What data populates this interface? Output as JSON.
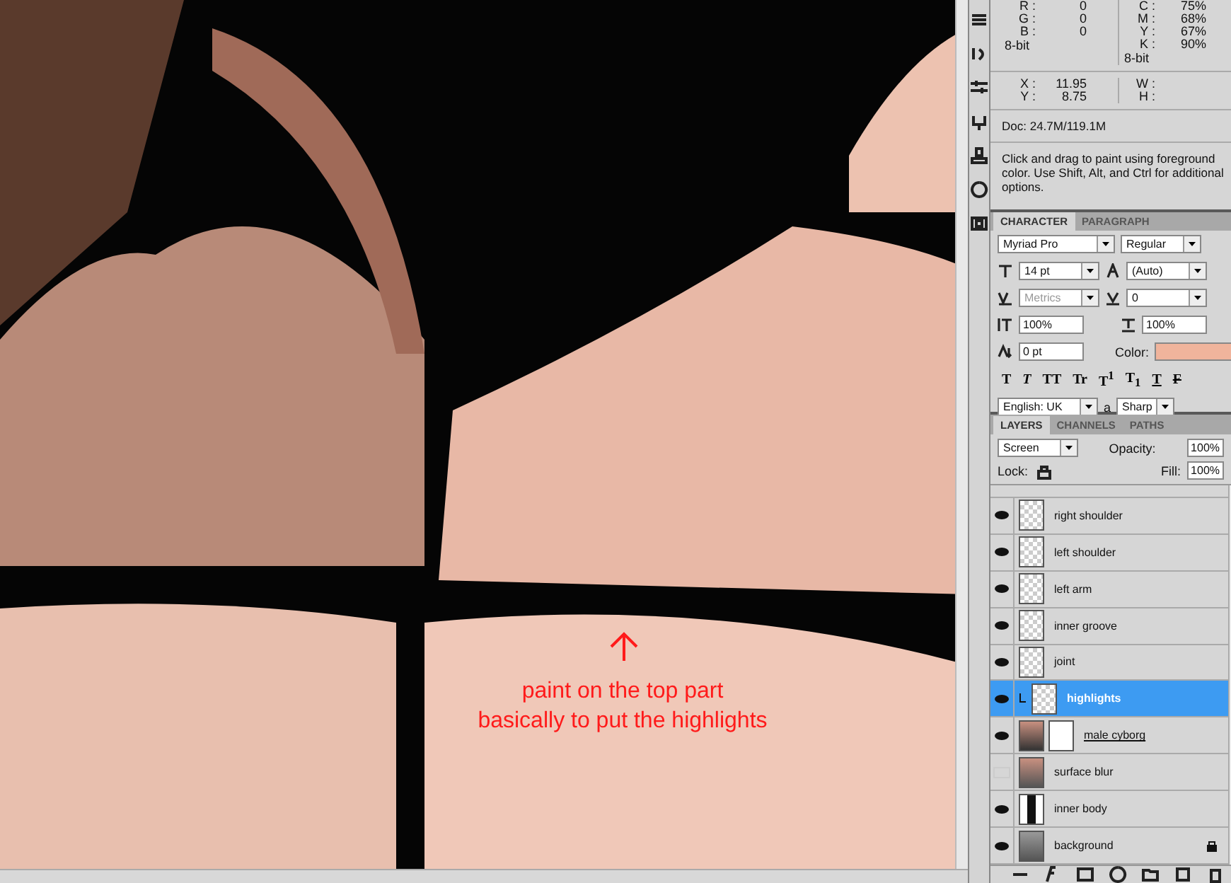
{
  "annotation": {
    "lines": [
      "paint on the top part",
      "basically to put the highlights"
    ]
  },
  "info": {
    "rgb": [
      {
        "label": "R :",
        "value": "0"
      },
      {
        "label": "G :",
        "value": "0"
      },
      {
        "label": "B :",
        "value": "0"
      }
    ],
    "rgb_depth": "8-bit",
    "cmyk": [
      {
        "label": "C :",
        "value": "75%"
      },
      {
        "label": "M :",
        "value": "68%"
      },
      {
        "label": "Y :",
        "value": "67%"
      },
      {
        "label": "K :",
        "value": "90%"
      }
    ],
    "cmyk_depth": "8-bit",
    "position": [
      {
        "label": "X :",
        "value": "11.95"
      },
      {
        "label": "Y :",
        "value": "8.75"
      }
    ],
    "size": [
      {
        "label": "W :"
      },
      {
        "label": "H :"
      }
    ],
    "doc": "Doc: 24.7M/119.1M",
    "help": "Click and drag to paint using foreground color.  Use Shift, Alt, and Ctrl for additional options."
  },
  "character": {
    "tabs": [
      {
        "label": "CHARACTER",
        "selected": true
      },
      {
        "label": "PARAGRAPH",
        "selected": false
      }
    ],
    "font": "Myriad Pro",
    "style": "Regular",
    "size": "14 pt",
    "leading": "(Auto)",
    "kerning": "Metrics",
    "kerning_disabled": true,
    "tracking": "0",
    "vscale": "100%",
    "hscale": "100%",
    "baseline": "0 pt",
    "color_label": "Color:",
    "color": "#f0b49c",
    "type_styles": [
      {
        "kind": "bold",
        "label": "T"
      },
      {
        "kind": "italic",
        "label": "T"
      },
      {
        "kind": "caps",
        "label": "TT"
      },
      {
        "kind": "smallcaps",
        "label": "Tr"
      },
      {
        "kind": "super",
        "label": "T$^{1}$"
      },
      {
        "kind": "sub",
        "label": "T$_{1}$"
      },
      {
        "kind": "underline",
        "label": "T"
      },
      {
        "kind": "strike",
        "label": "F"
      }
    ],
    "language": "English: UK",
    "aa_label": "a",
    "antialias": "Sharp"
  },
  "layers": {
    "tabs": [
      {
        "label": "LAYERS",
        "selected": true
      },
      {
        "label": "CHANNELS",
        "selected": false
      },
      {
        "label": "PATHS",
        "selected": false
      }
    ],
    "blend": "Screen",
    "opacity_label": "Opacity:",
    "opacity": "100%",
    "lock_label": "Lock:",
    "fill_label": "Fill:",
    "fill": "100%",
    "items": [
      {
        "name": "right shoulder",
        "visible": true,
        "selected": false,
        "kind": "plain",
        "locked": false,
        "clipped": false
      },
      {
        "name": "left shoulder",
        "visible": true,
        "selected": false,
        "kind": "plain",
        "locked": false,
        "clipped": false
      },
      {
        "name": "left arm",
        "visible": true,
        "selected": false,
        "kind": "plain",
        "locked": false,
        "clipped": false
      },
      {
        "name": "inner groove",
        "visible": true,
        "selected": false,
        "kind": "plain",
        "locked": false,
        "clipped": false
      },
      {
        "name": "joint",
        "visible": true,
        "selected": false,
        "kind": "plain",
        "locked": false,
        "clipped": false
      },
      {
        "name": "highlights",
        "visible": true,
        "selected": true,
        "kind": "plain",
        "locked": false,
        "clipped": true
      },
      {
        "name": "male cyborg",
        "visible": true,
        "selected": false,
        "kind": "masked",
        "locked": false,
        "clipped": false
      },
      {
        "name": "surface blur",
        "visible": false,
        "selected": false,
        "kind": "smart",
        "locked": false,
        "clipped": false
      },
      {
        "name": "inner body",
        "visible": true,
        "selected": false,
        "kind": "silhouette",
        "locked": false,
        "clipped": false
      },
      {
        "name": "background",
        "visible": true,
        "selected": false,
        "kind": "gradient",
        "locked": true,
        "clipped": false
      }
    ]
  }
}
